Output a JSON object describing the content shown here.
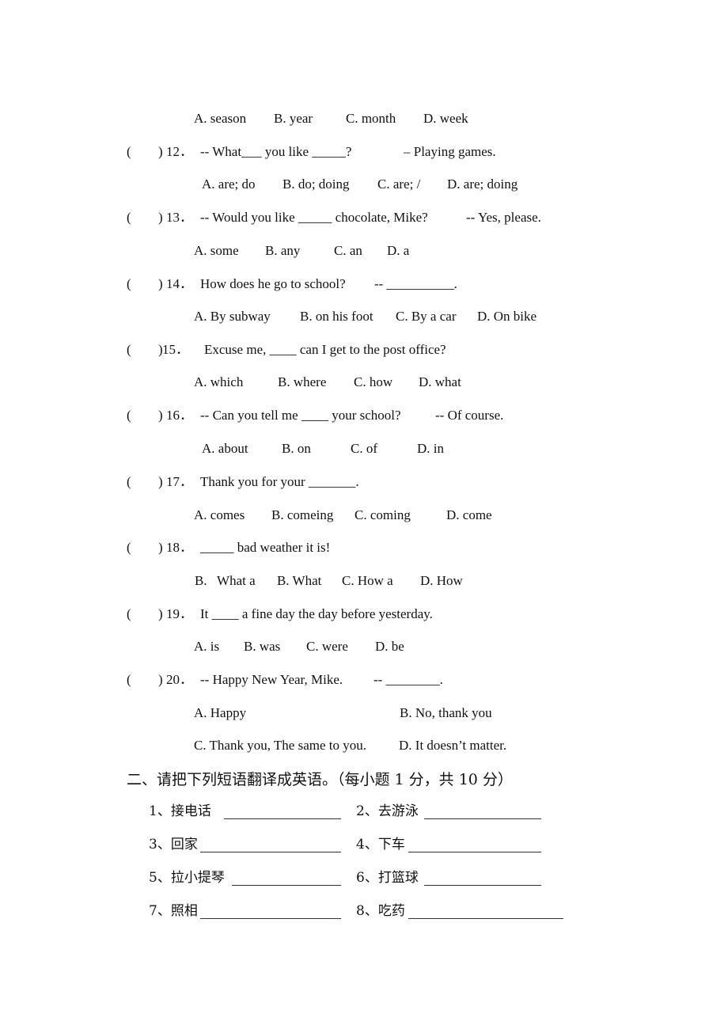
{
  "section1": {
    "q11": {
      "options": [
        "A. season",
        "B. year",
        "C. month",
        "D. week"
      ]
    },
    "questions": [
      {
        "paren_open": "(",
        "paren_close": ")",
        "number": "12．",
        "stem": "-- What___ you like _____?",
        "answer_hint": "– Playing games.",
        "options": [
          "A. are; do",
          "B. do; doing",
          "C. are; /",
          "D. are; doing"
        ]
      },
      {
        "paren_open": "(",
        "paren_close": ")",
        "number": "13．",
        "stem": "-- Would you like _____ chocolate, Mike?",
        "answer_hint": "-- Yes, please.",
        "options": [
          "A. some",
          "B. any",
          "C. an",
          "D. a"
        ]
      },
      {
        "paren_open": "(",
        "paren_close": ")",
        "number": "14．",
        "stem": "How does he go to school?",
        "answer_hint": "-- __________.",
        "options": [
          "A. By subway",
          "B. on his foot",
          "C. By a car",
          "D. On bike"
        ]
      },
      {
        "paren_open": "(",
        "paren_close": ")",
        "number": "15．",
        "stem": "Excuse me, ____ can I get to the post office?",
        "answer_hint": "",
        "options": [
          "A. which",
          "B. where",
          "C. how",
          "D. what"
        ]
      },
      {
        "paren_open": "(",
        "paren_close": ")",
        "number": "16．",
        "stem": "-- Can you tell me ____ your school?",
        "answer_hint": "-- Of course.",
        "options": [
          "A. about",
          "B. on",
          "C. of",
          "D. in"
        ]
      },
      {
        "paren_open": "(",
        "paren_close": ")",
        "number": "17．",
        "stem": "Thank you for your _______.",
        "answer_hint": "",
        "options": [
          "A. comes",
          "B. comeing",
          "C. coming",
          "D. come"
        ]
      },
      {
        "paren_open": "(",
        "paren_close": ")",
        "number": "18．",
        "stem": "_____ bad weather it is!",
        "answer_hint": "",
        "options": [
          "B.   What a",
          "B. What",
          "C. How a",
          "D. How"
        ]
      },
      {
        "paren_open": "(",
        "paren_close": ")",
        "number": "19．",
        "stem": "It ____ a fine day the day before yesterday.",
        "answer_hint": "",
        "options": [
          "A. is",
          "B. was",
          "C. were",
          "D. be"
        ]
      },
      {
        "paren_open": "(",
        "paren_close": ")",
        "number": "20．",
        "stem": "-- Happy New Year, Mike.",
        "answer_hint": "-- ________.",
        "options": [
          "A. Happy",
          "B. No, thank you",
          "C. Thank you, The same to you.",
          "D. It doesn’t matter."
        ]
      }
    ]
  },
  "section2": {
    "heading": "二、请把下列短语翻译成英语。（每小题 1 分，共 10 分）",
    "items": [
      {
        "label": "1、接电话"
      },
      {
        "label": "2、去游泳"
      },
      {
        "label": "3、回家"
      },
      {
        "label": "4、下车"
      },
      {
        "label": "5、拉小提琴"
      },
      {
        "label": "6、打篮球"
      },
      {
        "label": "7、照相"
      },
      {
        "label": "8、吃药"
      }
    ]
  }
}
